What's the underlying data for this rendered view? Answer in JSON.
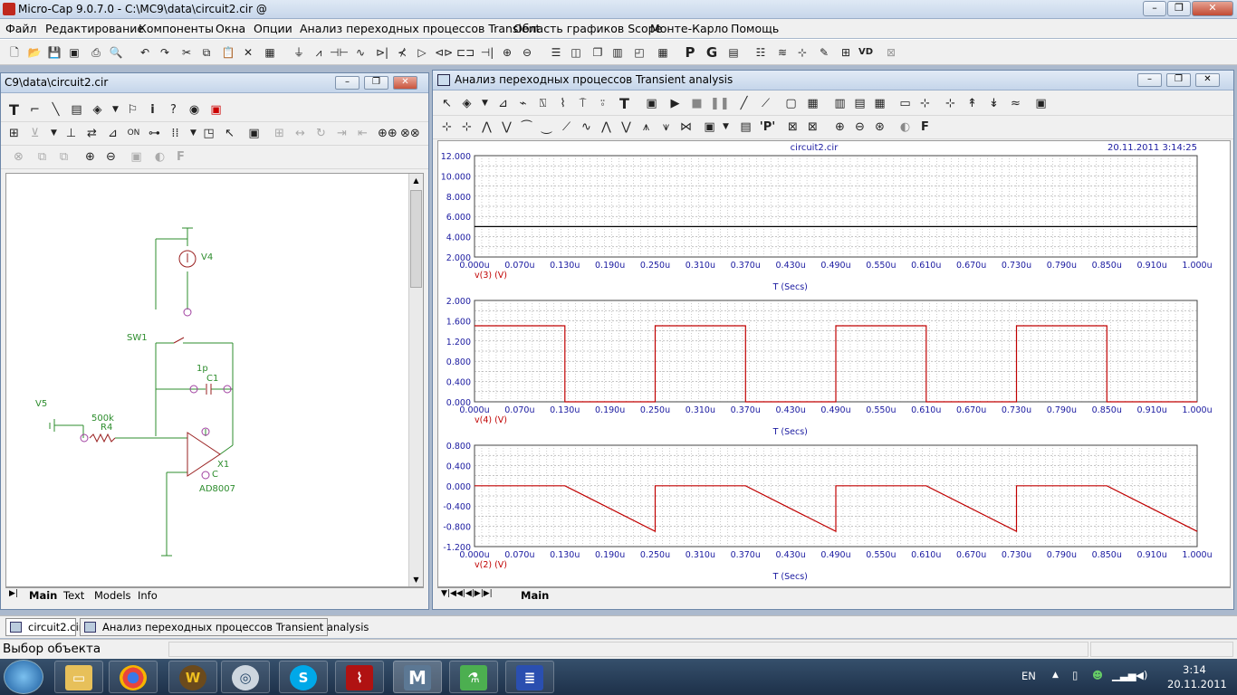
{
  "window": {
    "title": "Micro-Cap 9.0.7.0 - C:\\MC9\\data\\circuit2.cir @"
  },
  "menu": [
    "Файл",
    "Редактирование",
    "Компоненты",
    "Окна",
    "Опции",
    "Анализ переходных процессов Transient",
    "Область графиков Scope",
    "Монте-Карло",
    "Помощь"
  ],
  "schematic": {
    "title": "C9\\data\\circuit2.cir",
    "labels": {
      "v4": "V4",
      "sw1": "SW1",
      "c1_val": "1p",
      "c1": "C1",
      "v5": "V5",
      "r4_val": "500k",
      "r4": "R4",
      "x1": "X1",
      "c_lbl": "C",
      "ad": "AD8007"
    },
    "node_ids": [
      "4",
      "3",
      "3",
      "2",
      "2",
      "1",
      "0"
    ],
    "tabs": [
      "Main",
      "Text",
      "Models",
      "Info"
    ]
  },
  "analysis": {
    "title": "Анализ переходных процессов Transient analysis",
    "file": "circuit2.cir",
    "datetime": "20.11.2011 3:14:25",
    "tab": "Main"
  },
  "chart_data": [
    {
      "type": "line",
      "ylabel": "v(3) (V)",
      "xlabel": "T (Secs)",
      "ylim": [
        2,
        12
      ],
      "yticks": [
        "12.000",
        "10.000",
        "8.000",
        "6.000",
        "4.000",
        "2.000"
      ],
      "xticks": [
        "0.000u",
        "0.070u",
        "0.130u",
        "0.190u",
        "0.250u",
        "0.310u",
        "0.370u",
        "0.430u",
        "0.490u",
        "0.550u",
        "0.610u",
        "0.670u",
        "0.730u",
        "0.790u",
        "0.850u",
        "0.910u",
        "1.000u"
      ],
      "x": [
        0,
        1
      ],
      "y": [
        5,
        5
      ],
      "color": "#000000"
    },
    {
      "type": "line",
      "ylabel": "v(4) (V)",
      "xlabel": "T (Secs)",
      "ylim": [
        0,
        2
      ],
      "yticks": [
        "2.000",
        "1.600",
        "1.200",
        "0.800",
        "0.400",
        "0.000"
      ],
      "xticks": [
        "0.000u",
        "0.070u",
        "0.130u",
        "0.190u",
        "0.250u",
        "0.310u",
        "0.370u",
        "0.430u",
        "0.490u",
        "0.550u",
        "0.610u",
        "0.670u",
        "0.730u",
        "0.790u",
        "0.850u",
        "0.910u",
        "1.000u"
      ],
      "x": [
        0,
        0.125,
        0.125,
        0.25,
        0.25,
        0.375,
        0.375,
        0.5,
        0.5,
        0.625,
        0.625,
        0.75,
        0.75,
        0.875,
        0.875,
        1
      ],
      "y": [
        1.5,
        1.5,
        0,
        0,
        1.5,
        1.5,
        0,
        0,
        1.5,
        1.5,
        0,
        0,
        1.5,
        1.5,
        0,
        0
      ],
      "color": "#c00000"
    },
    {
      "type": "line",
      "ylabel": "v(2) (V)",
      "xlabel": "T (Secs)",
      "ylim": [
        -1.2,
        0.8
      ],
      "yticks": [
        "0.800",
        "0.400",
        "0.000",
        "-0.400",
        "-0.800",
        "-1.200"
      ],
      "xticks": [
        "0.000u",
        "0.070u",
        "0.130u",
        "0.190u",
        "0.250u",
        "0.310u",
        "0.370u",
        "0.430u",
        "0.490u",
        "0.550u",
        "0.610u",
        "0.670u",
        "0.730u",
        "0.790u",
        "0.850u",
        "0.910u",
        "1.000u"
      ],
      "x": [
        0,
        0.125,
        0.25,
        0.25,
        0.375,
        0.5,
        0.5,
        0.625,
        0.75,
        0.75,
        0.875,
        1
      ],
      "y": [
        0,
        0,
        -0.9,
        0,
        0,
        -0.9,
        0,
        0,
        -0.9,
        0,
        0,
        -0.9
      ],
      "color": "#c00000"
    }
  ],
  "doc_tabs": [
    "circuit2.cir",
    "Анализ переходных процессов Transient analysis"
  ],
  "status": "Выбор объекта",
  "taskbar": {
    "lang": "EN",
    "time": "3:14",
    "date": "20.11.2011"
  }
}
